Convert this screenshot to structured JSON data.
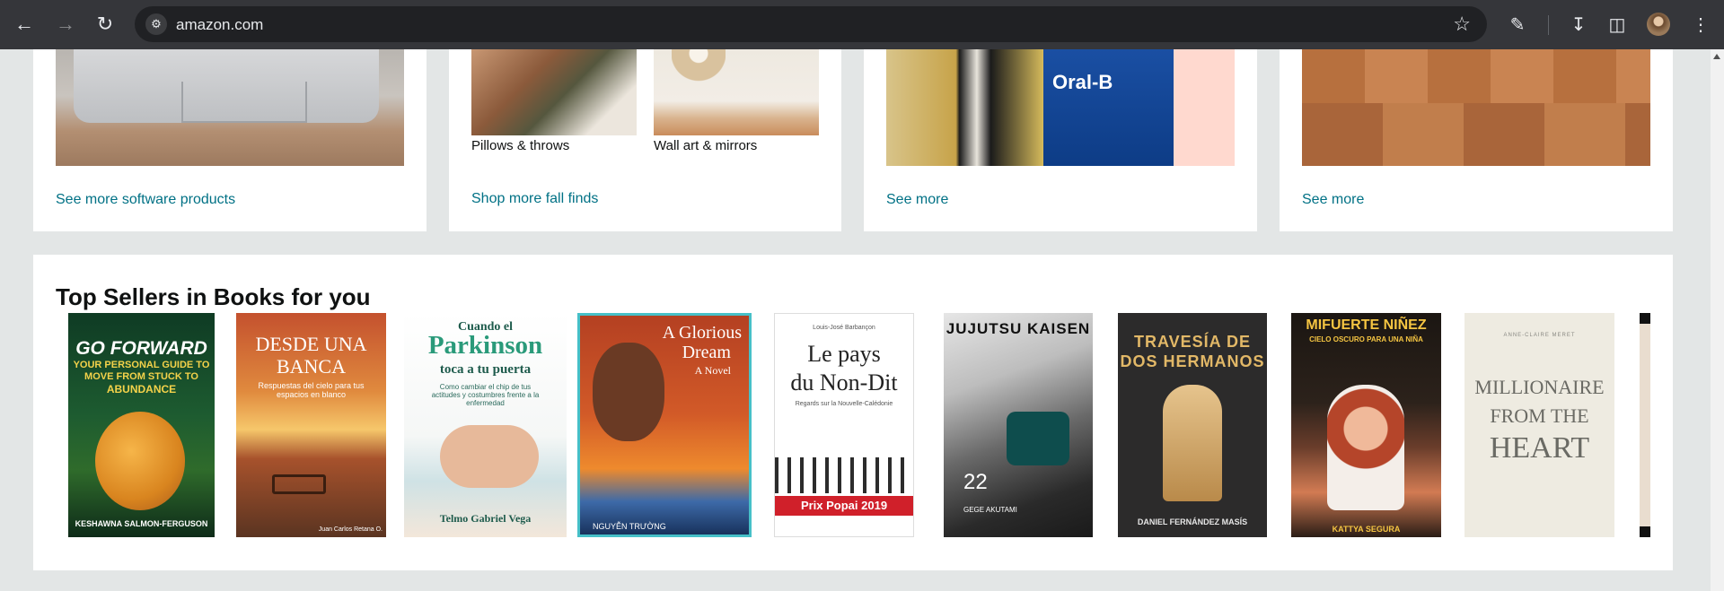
{
  "browser": {
    "url": "amazon.com"
  },
  "top_cards": [
    {
      "link": "See more software products"
    },
    {
      "items": [
        "Pillows & throws",
        "Wall art & mirrors"
      ],
      "link": "Shop more fall finds"
    },
    {
      "link": "See more"
    },
    {
      "link": "See more"
    }
  ],
  "books_section": {
    "title": "Top Sellers in Books for you",
    "books": [
      {
        "title_lines": [
          "GO FORWARD",
          "YOUR PERSONAL GUIDE TO",
          "MOVE FROM STUCK TO",
          "ABUNDANCE"
        ],
        "author": "KESHAWNA SALMON-FERGUSON"
      },
      {
        "title_lines": [
          "DESDE UNA",
          "BANCA"
        ],
        "subtitle": "Respuestas del cielo para tus espacios en blanco",
        "author": "Juan Carlos Retana O."
      },
      {
        "title_lines": [
          "Cuando el",
          "Parkinson",
          "toca a tu puerta"
        ],
        "subtitle": "Como cambiar el chip de tus actitudes y costumbres frente a la enfermedad",
        "author": "Telmo Gabriel Vega"
      },
      {
        "title_lines": [
          "A Glorious",
          "Dream"
        ],
        "subtitle": "A Novel",
        "author": "NGUYỄN TRƯỜNG"
      },
      {
        "author": "Louis-José Barbançon",
        "title_lines": [
          "Le pays",
          "du Non-Dit"
        ],
        "subtitle": "Regards sur la Nouvelle-Calédonie",
        "badge": "Prix Popai 2019"
      },
      {
        "title_lines": [
          "JUJUTSU KAISEN"
        ],
        "volume": "22",
        "author": "GEGE AKUTAMI"
      },
      {
        "title_lines": [
          "TRAVESÍA DE",
          "DOS HERMANOS"
        ],
        "author": "DANIEL FERNÁNDEZ MASÍS"
      },
      {
        "title_lines": [
          "MIFUERTE NIÑEZ"
        ],
        "subtitle": "CIELO OSCURO PARA UNA NIÑA",
        "author": "KATTYA SEGURA"
      },
      {
        "author": "ANNE-CLAIRE MERET",
        "title_lines": [
          "MILLIONAIRE",
          "FROM THE",
          "HEART"
        ]
      }
    ]
  }
}
